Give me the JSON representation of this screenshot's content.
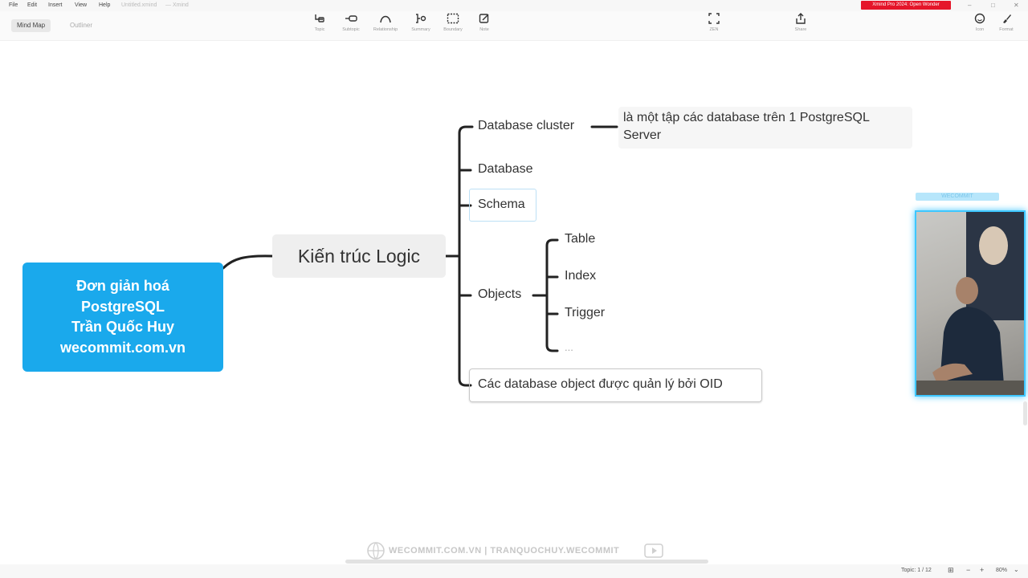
{
  "menubar": {
    "items": [
      "File",
      "Edit",
      "Insert",
      "View",
      "Help"
    ],
    "doc_title": "Untitled.xmind",
    "app_name": "— Xmind",
    "promo": "Xmind Pro 2024: Open Wonder"
  },
  "toolbar": {
    "view_tabs": [
      "Mind Map",
      "Outliner"
    ],
    "tools": [
      {
        "label": "Topic",
        "icon": "topic-icon"
      },
      {
        "label": "Subtopic",
        "icon": "subtopic-icon"
      },
      {
        "label": "Relationship",
        "icon": "relationship-icon"
      },
      {
        "label": "Summary",
        "icon": "summary-icon"
      },
      {
        "label": "Boundary",
        "icon": "boundary-icon"
      },
      {
        "label": "Note",
        "icon": "note-icon"
      }
    ],
    "zen_label": "ZEN",
    "share_label": "Share",
    "right_tools": [
      "Icon",
      "Format"
    ]
  },
  "mindmap": {
    "root": {
      "lines": [
        "Đơn giản hoá",
        "PostgreSQL",
        "Trần Quốc Huy",
        "wecommit.com.vn"
      ],
      "color": "#1aa9ec"
    },
    "main_topic": "Kiến trúc Logic",
    "subtopics": {
      "database_cluster": "Database cluster",
      "database": "Database",
      "schema": "Schema",
      "objects": "Objects",
      "oid_note": "Các database object được quản lý bởi OID"
    },
    "cluster_note": "là một tập các database trên 1 PostgreSQL Server",
    "objects_children": [
      "Table",
      "Index",
      "Trigger",
      "..."
    ]
  },
  "webcam": {
    "label": "WECOMMIT"
  },
  "watermark": {
    "text": "WECOMMIT.COM.VN  |  TRANQUOCHUY.WECOMMIT"
  },
  "statusbar": {
    "topic_count": "Topic: 1 / 12",
    "zoom": "80%"
  },
  "colors": {
    "accent": "#1aa9ec",
    "webcam_border": "#3ec7ff",
    "promo": "#e5162a"
  }
}
